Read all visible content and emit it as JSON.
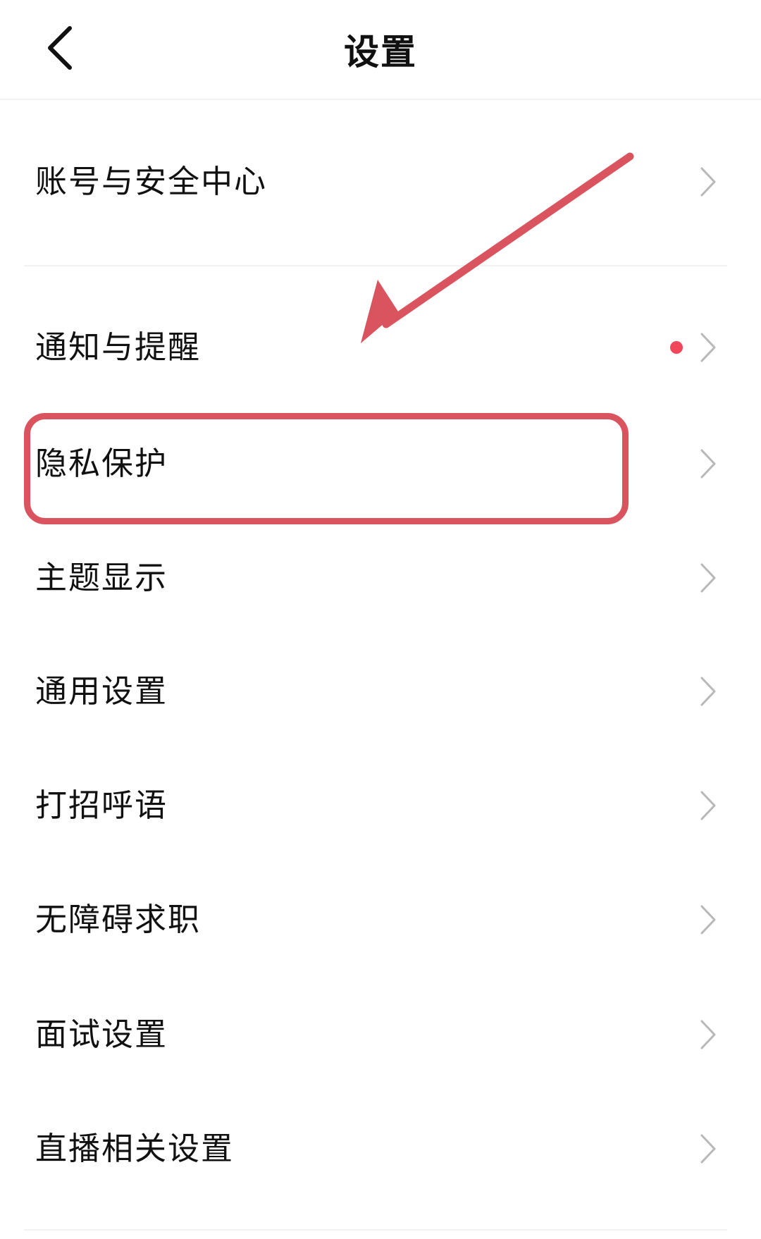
{
  "header": {
    "title": "设置",
    "back_icon": "chevron-left-icon"
  },
  "colors": {
    "annotation": "#d9545f",
    "badge": "#f0475a",
    "chevron": "#b8b8b8",
    "divider": "#f2f2f2"
  },
  "settings": {
    "items": [
      {
        "label": "账号与安全中心"
      },
      {
        "label": "通知与提醒",
        "has_badge": true
      },
      {
        "label": "隐私保护",
        "highlighted": true
      },
      {
        "label": "主题显示"
      },
      {
        "label": "通用设置"
      },
      {
        "label": "打招呼语"
      },
      {
        "label": "无障碍求职"
      },
      {
        "label": "面试设置"
      },
      {
        "label": "直播相关设置"
      }
    ]
  },
  "annotation": {
    "arrow_icon": "arrow-pointer-icon",
    "highlight": "highlight-box"
  }
}
